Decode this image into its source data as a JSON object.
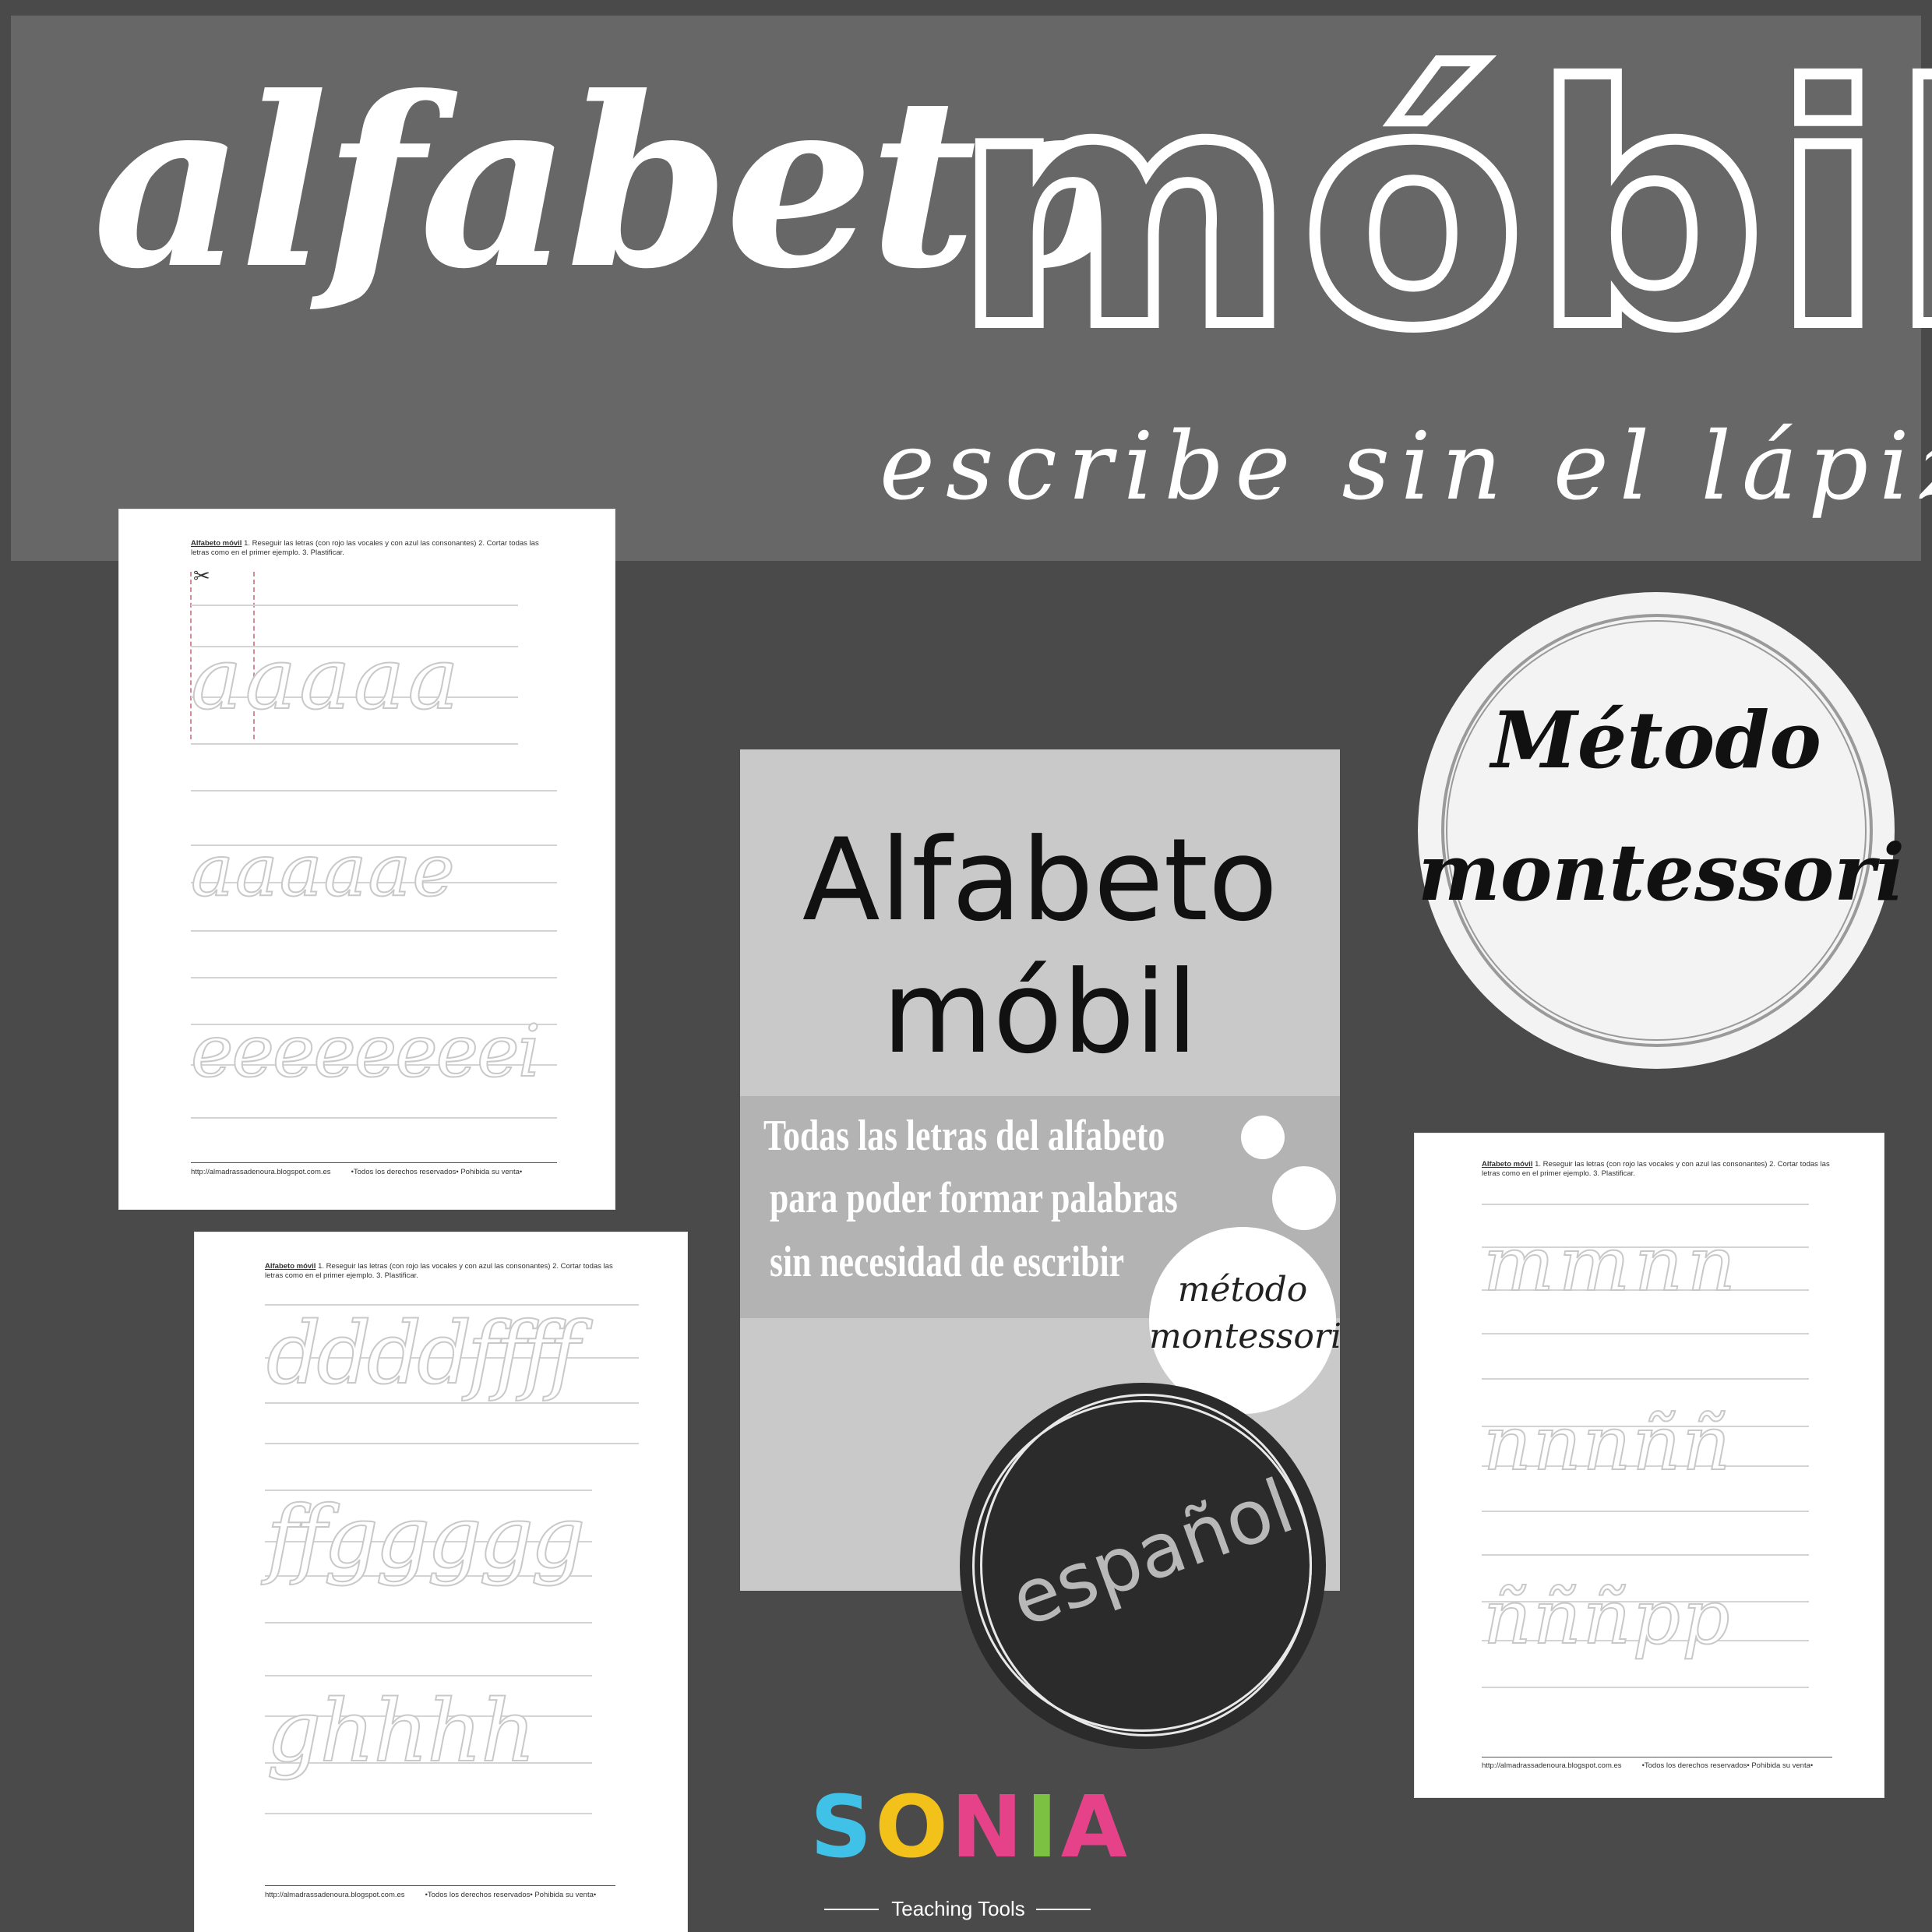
{
  "banner": {
    "title_script": "alfabeto",
    "title_block": "móbil",
    "subtitle": "escribe sin el lápiz"
  },
  "worksheets": {
    "instruction_title": "Alfabeto móvil",
    "instruction_rest": " 1. Reseguir las letras (con rojo las vocales y con azul las consonantes) 2. Cortar todas las letras como en el primer ejemplo. 3. Plastificar.",
    "footer_url": "http://almadrassadenoura.blogspot.com.es",
    "footer_rights": "•Todos los derechos reservados• Pohibida su venta•",
    "sheet1_rows": [
      "aaaaa",
      "aaaaae",
      "eeeeeeeei"
    ],
    "sheet2_rows": [
      "ddddffff",
      "ffggggg",
      "ghhhh"
    ],
    "sheet3_rows": [
      "mmnn",
      "nnnññ",
      "ñññpp"
    ]
  },
  "cover": {
    "title_line1": "Alfabeto",
    "title_line2": "móbil",
    "text_line1": "Todas las letras del alfabeto",
    "text_line2": "para poder formar palabras",
    "text_line3": "sin necesidad de escribir",
    "badge_line1": "método",
    "badge_line2": "montessori",
    "language": "español"
  },
  "montessori_badge": {
    "line1": "Método",
    "line2": "montessori"
  },
  "logo": {
    "letters": [
      "S",
      "O",
      "N",
      "I",
      "A"
    ],
    "letter_colors": [
      "#3fc1e8",
      "#f2c21b",
      "#e5428a",
      "#7cc142",
      "#e5428a"
    ],
    "tagline": "Teaching Tools"
  }
}
